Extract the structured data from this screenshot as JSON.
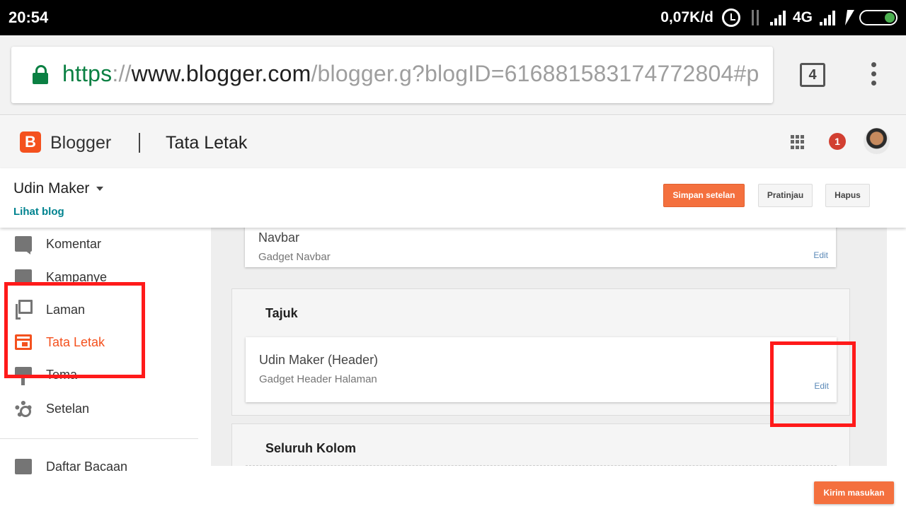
{
  "status_bar": {
    "time": "20:54",
    "network_speed": "0,07K/d",
    "network_type": "4G",
    "icons": [
      "alarm-icon",
      "data-arrows-icon",
      "signal-icon",
      "signal-icon",
      "charging-icon",
      "battery-icon"
    ]
  },
  "browser": {
    "url_scheme": "https",
    "url_separator": "://",
    "url_domain": "www.blogger.com",
    "url_path": "/blogger.g?blogID=616881583174772804#p",
    "tab_count": "4",
    "colors": {
      "secure": "#0b8043"
    }
  },
  "header": {
    "logo_letter": "B",
    "app_name": "Blogger",
    "section_title": "Tata Letak",
    "notification_count": "1",
    "colors": {
      "brand": "#f4511e"
    }
  },
  "topbar": {
    "blog_name": "Udin Maker",
    "view_blog_label": "Lihat blog",
    "save_label": "Simpan setelan",
    "preview_label": "Pratinjau",
    "delete_label": "Hapus"
  },
  "sidebar": {
    "items": [
      {
        "label": "Komentar",
        "icon": "comment-icon"
      },
      {
        "label": "Kampanye",
        "icon": "campaign-icon"
      },
      {
        "label": "Laman",
        "icon": "pages-icon"
      },
      {
        "label": "Tata Letak",
        "icon": "layout-icon",
        "active": true
      },
      {
        "label": "Tema",
        "icon": "theme-icon"
      },
      {
        "label": "Setelan",
        "icon": "gear-icon"
      },
      {
        "label": "Daftar Bacaan",
        "icon": "reading-list-icon"
      }
    ]
  },
  "main": {
    "navbar_gadget": {
      "title": "Navbar",
      "subtitle": "Gadget Navbar",
      "edit_label": "Edit"
    },
    "sections": [
      {
        "title": "Tajuk",
        "gadgets": [
          {
            "title": "Udin Maker (Header)",
            "subtitle": "Gadget Header Halaman",
            "edit_label": "Edit"
          }
        ]
      },
      {
        "title": "Seluruh Kolom",
        "gadgets": []
      }
    ]
  },
  "feedback_label": "Kirim masukan"
}
